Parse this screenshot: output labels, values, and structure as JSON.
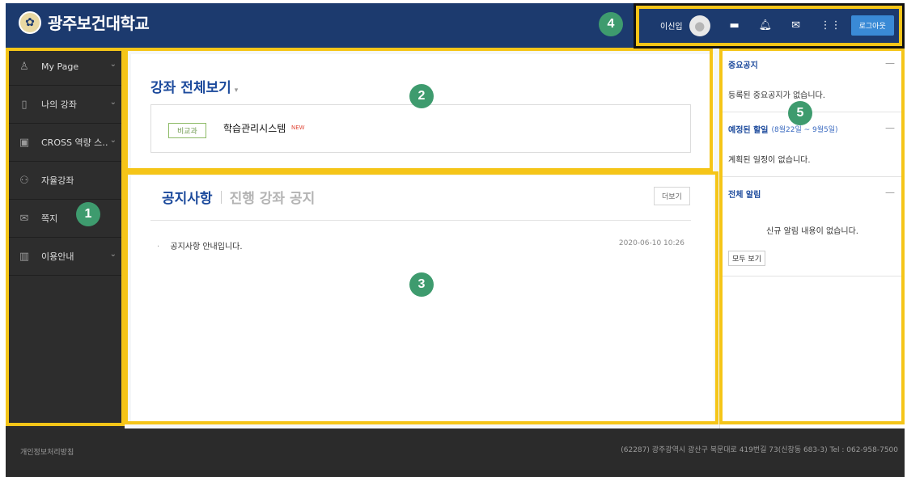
{
  "header": {
    "logo_text": "광주보건대학교",
    "user_name": "이신입",
    "logout_label": "로그아웃",
    "icons": [
      "monitor-icon",
      "bell-icon",
      "mail-icon",
      "grid-icon"
    ]
  },
  "sidebar": {
    "items": [
      {
        "label": "My Page",
        "icon": "user-icon",
        "has_chevron": true
      },
      {
        "label": "나의 강좌",
        "icon": "book-icon",
        "has_chevron": true
      },
      {
        "label": "CROSS 역량 스…",
        "icon": "board-icon",
        "has_chevron": true
      },
      {
        "label": "자율강좌",
        "icon": "group-icon",
        "has_chevron": false
      },
      {
        "label": "쪽지",
        "icon": "envelope-icon",
        "has_chevron": false
      },
      {
        "label": "이용안내",
        "icon": "map-icon",
        "has_chevron": true
      }
    ]
  },
  "courses": {
    "title": "강좌 전체보기",
    "item": {
      "tag": "비교과",
      "name": "학습관리시스템",
      "badge": "NEW"
    }
  },
  "notices": {
    "tab_active": "공지사항",
    "tab_inactive": "진행 강좌 공지",
    "more_label": "더보기",
    "rows": [
      {
        "title": "공지사항 안내입니다.",
        "date": "2020-06-10 10:26"
      }
    ]
  },
  "right_panel": {
    "important": {
      "title": "중요공지",
      "body": "등록된 중요공지가 없습니다."
    },
    "schedule": {
      "title": "예정된 할일",
      "range": "(8월22일 ~ 9월5일)",
      "body": "계획된 일정이 없습니다."
    },
    "alerts": {
      "title": "전체 알림",
      "body": "신규 알림 내용이 없습니다.",
      "view_all": "모두 보기"
    },
    "toggle_symbol": "—"
  },
  "footer": {
    "privacy": "개인정보처리방침",
    "address": "(62287) 광주광역시 광산구 북문대로 419번길 73(신창동 683-3) Tel : 062-958-7500"
  },
  "badges": [
    "1",
    "2",
    "3",
    "4",
    "5"
  ],
  "colors": {
    "header_bg": "#1c3a6e",
    "sidebar_bg": "#2d2d2d",
    "highlight": "#f5c518",
    "badge": "#3e9b6e",
    "accent": "#1c4a9c",
    "logout": "#3a8ad6"
  }
}
